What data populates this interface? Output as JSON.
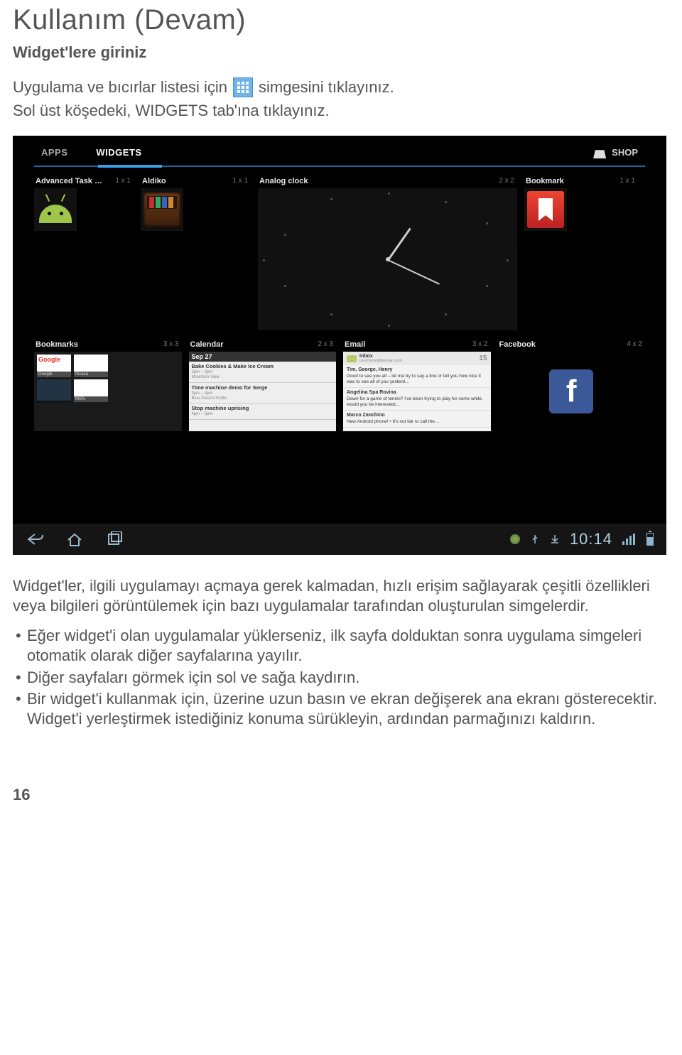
{
  "page": {
    "title": "Kullanım (Devam)",
    "subtitle": "Widget'lere giriniz",
    "intro_before": "Uygulama ve bıcırlar listesi için",
    "intro_after": "simgesini tıklayınız.",
    "intro_line2_a": "Sol üst köşedeki, ",
    "intro_line2_b": "WIDGETS",
    "intro_line2_c": " tab'ına tıklayınız.",
    "page_number": "16"
  },
  "screenshot": {
    "tabs": {
      "apps": "APPS",
      "widgets": "WIDGETS"
    },
    "shop": "SHOP",
    "row1": [
      {
        "name": "Advanced Task Killer Free",
        "size": "1 x 1"
      },
      {
        "name": "Aldiko",
        "size": "1 x 1"
      },
      {
        "name": "Analog clock",
        "size": "2 x 2"
      },
      {
        "name": "Bookmark",
        "size": "1 x 1"
      }
    ],
    "row2": [
      {
        "name": "Bookmarks",
        "size": "3 x 3"
      },
      {
        "name": "Calendar",
        "size": "2 x 3"
      },
      {
        "name": "Email",
        "size": "3 x 2"
      },
      {
        "name": "Facebook",
        "size": "4 x 2"
      }
    ],
    "bookmarks_tiles": [
      "Google",
      "Picasa",
      "",
      "MSN"
    ],
    "calendar": {
      "date": "Sep 27",
      "events": [
        {
          "title": "Bake Cookies & Make Ice Cream",
          "time": "2pm – 3pm",
          "loc": "Mountain View"
        },
        {
          "title": "Time machine demo for Serge",
          "time": "3pm – 4pm",
          "loc": "Blue Palace Public"
        },
        {
          "title": "Stop machine uprising",
          "time": "4pm – 5pm",
          "loc": ""
        }
      ]
    },
    "email": {
      "label": "Inbox",
      "account": "username@domain.com",
      "count": "15",
      "items": [
        {
          "from": "Tim, George, Henry",
          "snip": "Good to see you all – let me try to say a line or tell you how nice it was to see all of you yesterd…"
        },
        {
          "from": "Angelina Spa Rovina",
          "snip": "Down for a game of tennis? I've been trying to play for some while, would you be interested…"
        },
        {
          "from": "Marco Zanchino",
          "snip": "New Android phone! • It's not fair to call the…"
        }
      ]
    },
    "facebook_letter": "f",
    "clock": "10:14"
  },
  "body": {
    "para": "Widget'ler, ilgili uygulamayı açmaya gerek kalmadan, hızlı erişim sağlayarak çeşitli özellikleri veya bilgileri görüntülemek için bazı uygulamalar tarafından oluşturulan simgelerdir.",
    "bullets": [
      "Eğer widget'i olan uygulamalar yüklerseniz, ilk sayfa dolduktan sonra uygulama simgeleri otomatik olarak diğer sayfalarına yayılır.",
      "Diğer sayfaları görmek için sol ve sağa kaydırın.",
      "Bir widget'i kullanmak için, üzerine uzun basın ve ekran değişerek ana ekranı gösterecektir. Widget'i yerleştirmek istediğiniz konuma sürükleyin, ardından parmağınızı kaldırın."
    ]
  }
}
